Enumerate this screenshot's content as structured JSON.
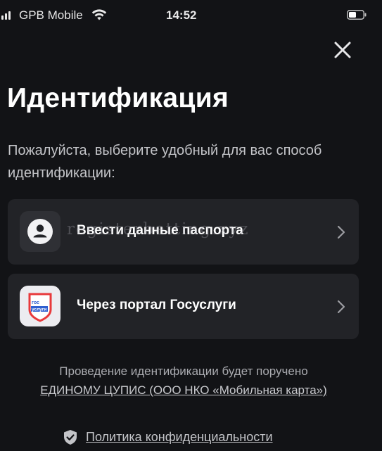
{
  "status_bar": {
    "carrier": "GPB Mobile",
    "time": "14:52"
  },
  "title": "Идентификация",
  "subtitle": "Пожалуйста, выберите удобный для вас способ идентификации:",
  "options": [
    {
      "label": "Ввести данные паспорта",
      "icon": "person-icon"
    },
    {
      "label": "Через портал Госуслуги",
      "icon": "gosuslugi-logo",
      "logo_text_top": "гос",
      "logo_text_bottom": "услуги"
    }
  ],
  "watermark": "registerbetting.xyz",
  "notice": {
    "line1": "Проведение идентификации будет поручено",
    "link": "ЕДИНОМУ ЦУПИС (ООО НКО «Мобильная карта»)"
  },
  "privacy_link": "Политика конфиденциальности",
  "colors": {
    "background": "#121316",
    "card": "#222327",
    "text_primary": "#ffffff",
    "text_secondary": "#c3c4c8",
    "gosuslugi_blue": "#2f5fd0",
    "gosuslugi_red": "#e8393b"
  }
}
